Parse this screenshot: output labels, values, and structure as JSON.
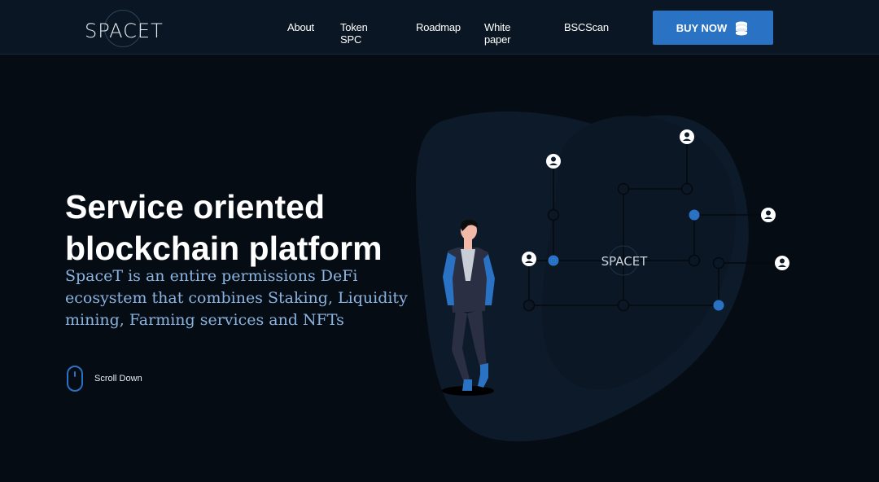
{
  "brand": {
    "logo_text": "SPACET"
  },
  "nav": {
    "items": [
      "About",
      "Token SPC",
      "Roadmap",
      "White paper",
      "BSCScan"
    ],
    "buy_label": "BUY NOW"
  },
  "hero": {
    "title": "Service oriented blockchain platform",
    "subtitle": "SpaceT is an entire permissions DeFi ecosystem that combines Staking, Liquidity mining, Farming services and NFTs",
    "scroll_label": "Scroll Down"
  },
  "illustration": {
    "center_logo_text": "SPACET"
  },
  "colors": {
    "background": "#060c14",
    "navbar": "#0a1623",
    "accent": "#2a72c4",
    "subtitle": "#8ab4e0",
    "blob": "#0d1a29"
  },
  "icons": [
    "coins-icon",
    "mouse-icon",
    "user-icon"
  ]
}
